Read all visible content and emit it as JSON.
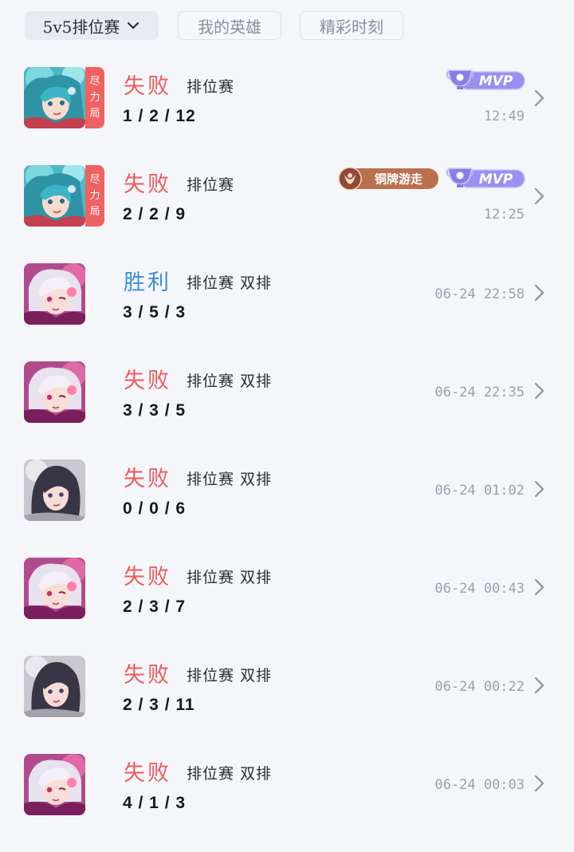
{
  "filters": {
    "active_label": "5v5排位赛",
    "my_heroes_label": "我的英雄",
    "highlights_label": "精彩时刻"
  },
  "badges": {
    "mvp": "MVP",
    "bronze_roamer": "铜牌游走",
    "effort_tag": [
      "尽",
      "力",
      "局"
    ]
  },
  "colors": {
    "lose": "#ef5b5b",
    "win": "#3a8fd8",
    "mvp_purple": "#9b8ff0",
    "bronze": "#b8704f"
  },
  "matches": [
    {
      "result": "失败",
      "mode": "排位赛",
      "kda": "1 / 2 / 12",
      "time": "12:49",
      "hero": "hero-a",
      "effort": true,
      "mvp": true,
      "bronze": false,
      "outcome": "lose"
    },
    {
      "result": "失败",
      "mode": "排位赛",
      "kda": "2 / 2 / 9",
      "time": "12:25",
      "hero": "hero-a",
      "effort": true,
      "mvp": true,
      "bronze": true,
      "outcome": "lose"
    },
    {
      "result": "胜利",
      "mode": "排位赛 双排",
      "kda": "3 / 5 / 3",
      "time": "06-24 22:58",
      "hero": "hero-b",
      "effort": false,
      "mvp": false,
      "bronze": false,
      "outcome": "win"
    },
    {
      "result": "失败",
      "mode": "排位赛 双排",
      "kda": "3 / 3 / 5",
      "time": "06-24 22:35",
      "hero": "hero-b",
      "effort": false,
      "mvp": false,
      "bronze": false,
      "outcome": "lose"
    },
    {
      "result": "失败",
      "mode": "排位赛 双排",
      "kda": "0 / 0 / 6",
      "time": "06-24 01:02",
      "hero": "hero-c",
      "effort": false,
      "mvp": false,
      "bronze": false,
      "outcome": "lose"
    },
    {
      "result": "失败",
      "mode": "排位赛 双排",
      "kda": "2 / 3 / 7",
      "time": "06-24 00:43",
      "hero": "hero-b",
      "effort": false,
      "mvp": false,
      "bronze": false,
      "outcome": "lose"
    },
    {
      "result": "失败",
      "mode": "排位赛 双排",
      "kda": "2 / 3 / 11",
      "time": "06-24 00:22",
      "hero": "hero-c",
      "effort": false,
      "mvp": false,
      "bronze": false,
      "outcome": "lose"
    },
    {
      "result": "失败",
      "mode": "排位赛 双排",
      "kda": "4 / 1 / 3",
      "time": "06-24 00:03",
      "hero": "hero-b",
      "effort": false,
      "mvp": false,
      "bronze": false,
      "outcome": "lose"
    }
  ]
}
